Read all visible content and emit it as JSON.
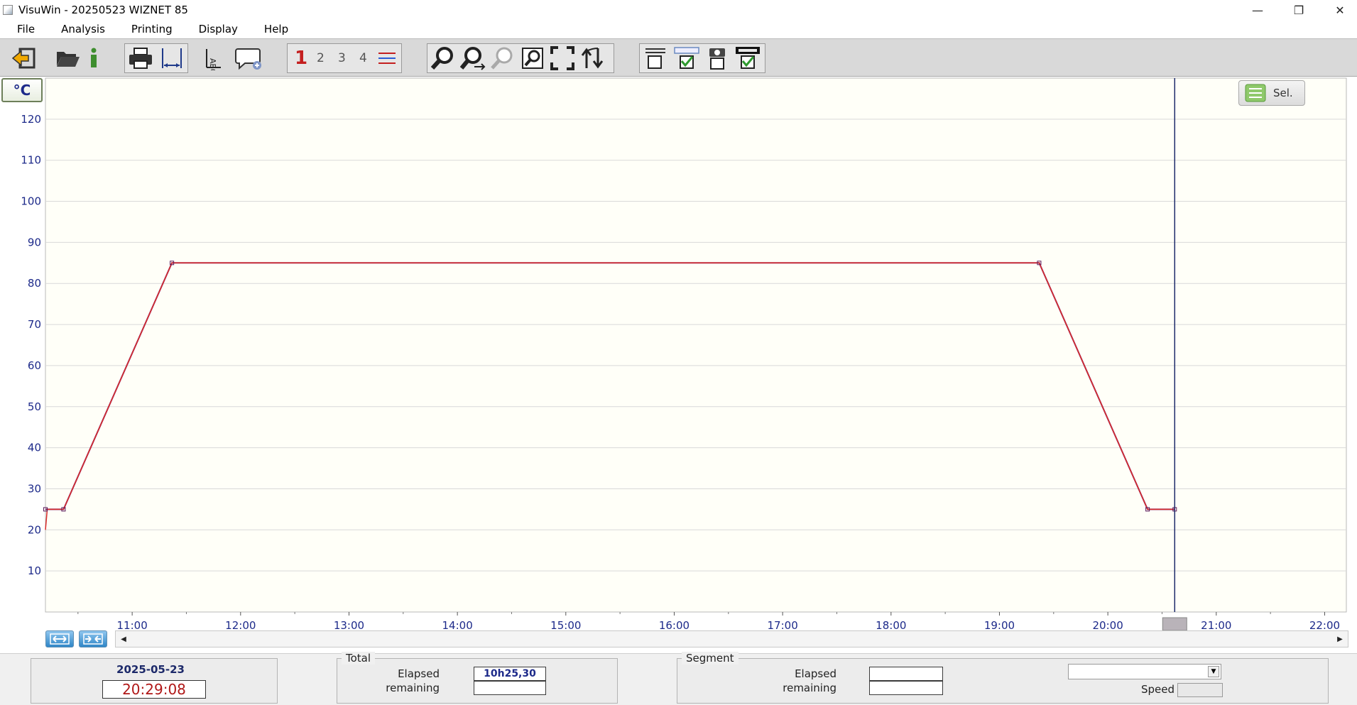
{
  "window": {
    "title": "VisuWin - 20250523 WIZNET 85",
    "minimize_glyph": "—",
    "restore_glyph": "❐",
    "close_glyph": "✕"
  },
  "menu": [
    "File",
    "Analysis",
    "Printing",
    "Display",
    "Help"
  ],
  "toolbar": {
    "channel_numbers": [
      "1",
      "2",
      "3",
      "4"
    ],
    "icons": [
      "exit-icon",
      "open-folder-icon",
      "info-icon",
      "printer-icon",
      "page-width-icon",
      "text-label-icon",
      "comment-icon",
      "channel-list-icon",
      "zoom-icon",
      "zoom-horizontal-icon",
      "zoom-out-icon",
      "zoom-window-icon",
      "fit-all-icon",
      "swap-icon",
      "table-unchecked-icon",
      "table-checked-icon",
      "camera-icon",
      "monitor-checked-icon"
    ]
  },
  "chart": {
    "unit": "°C",
    "sel_label": "Sel."
  },
  "chart_data": {
    "type": "line",
    "xlabel": "",
    "ylabel": "",
    "ylim": [
      0,
      130
    ],
    "xlim": [
      "10:12",
      "22:12"
    ],
    "yticks": [
      10,
      20,
      30,
      40,
      50,
      60,
      70,
      80,
      90,
      100,
      110,
      120
    ],
    "xticks": [
      "11:00",
      "12:00",
      "13:00",
      "14:00",
      "15:00",
      "16:00",
      "17:00",
      "18:00",
      "19:00",
      "20:00",
      "21:00",
      "22:00"
    ],
    "grid": true,
    "series": [
      {
        "color": "#d92b2b",
        "x": [
          "10:12",
          "10:13",
          "10:22",
          "11:22",
          "19:22",
          "20:22",
          "20:37"
        ],
        "y": [
          20,
          25,
          25,
          85,
          85,
          25,
          25
        ]
      }
    ],
    "setpoint_series": {
      "color": "#6a1a6a",
      "x": [
        "10:12",
        "10:22",
        "11:22",
        "19:22",
        "20:22",
        "20:37"
      ],
      "y": [
        25,
        25,
        85,
        85,
        25,
        25
      ]
    },
    "cursor_time": "20:37"
  },
  "status": {
    "date": "2025-05-23",
    "time": "20:29:08",
    "total": {
      "title": "Total",
      "elapsed_label": "Elapsed",
      "remaining_label": "remaining",
      "elapsed_value": "10h25,30",
      "remaining_value": ""
    },
    "segment": {
      "title": "Segment",
      "elapsed_label": "Elapsed",
      "remaining_label": "remaining",
      "elapsed_value": "",
      "remaining_value": ""
    },
    "speed_label": "Speed"
  }
}
